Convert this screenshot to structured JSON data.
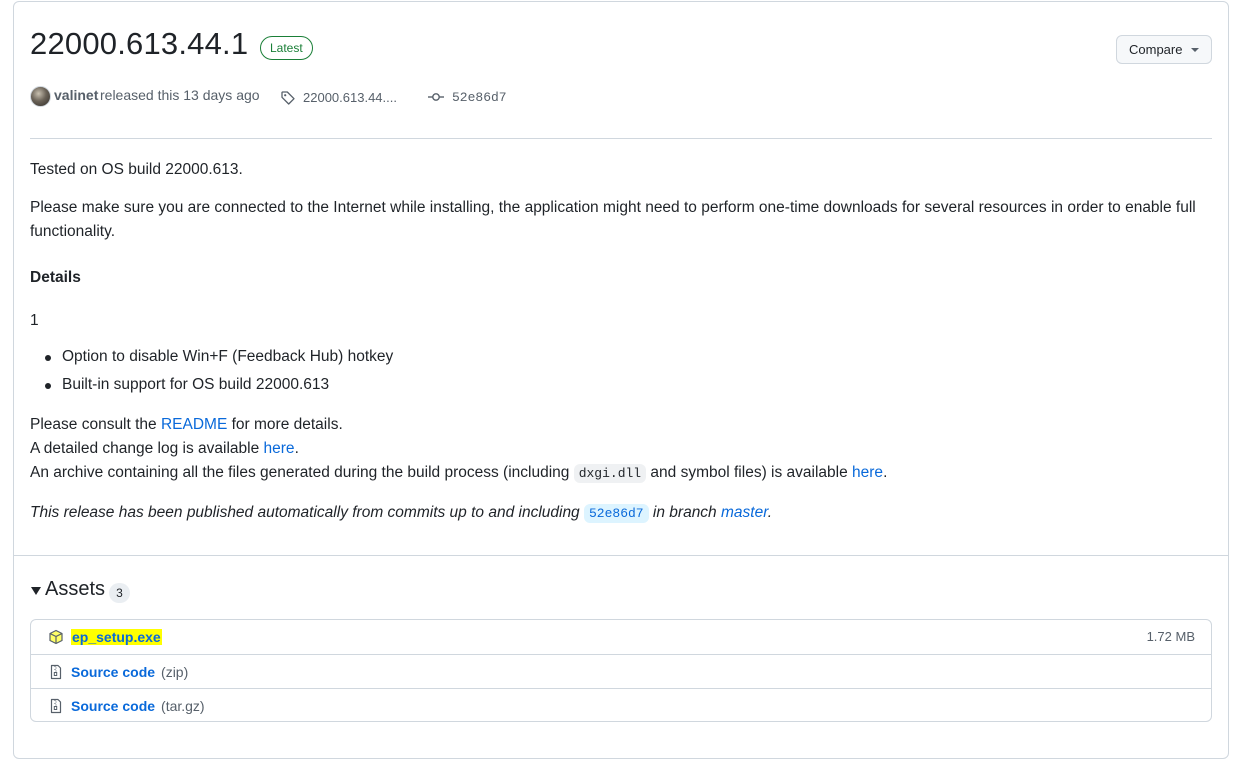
{
  "release": {
    "title": "22000.613.44.1",
    "latest_badge": "Latest",
    "compare_label": "Compare",
    "author": "valinet",
    "released_text": "released this 13 days ago",
    "tag": "22000.613.44....",
    "commit": "52e86d7"
  },
  "notes": {
    "tested": "Tested on OS build 22000.613.",
    "connect": "Please make sure you are connected to the Internet while installing, the application might need to perform one-time downloads for several resources in order to enable full functionality.",
    "details_heading": "Details",
    "number": "1",
    "bullets": [
      "Option to disable Win+F (Feedback Hub) hotkey",
      "Built-in support for OS build 22000.613"
    ],
    "consult_before": "Please consult the ",
    "consult_link": "README",
    "consult_after": " for more details.",
    "changelog_before": "A detailed change log is available ",
    "changelog_link": "here",
    "changelog_after": ".",
    "archive_before": "An archive containing all the files generated during the build process (including ",
    "archive_code": "dxgi.dll",
    "archive_mid": " and symbol files) is available ",
    "archive_link": "here",
    "archive_after": ".",
    "auto_before": "This release has been published automatically from commits up to and including ",
    "auto_code": "52e86d7",
    "auto_mid": " in branch ",
    "auto_link": "master",
    "auto_after": "."
  },
  "assets": {
    "title": "Assets",
    "count": "3",
    "items": [
      {
        "name": "ep_setup.exe",
        "suffix": "",
        "size": "1.72 MB",
        "icon": "package-icon",
        "highlighted": true
      },
      {
        "name": "Source code",
        "suffix": "(zip)",
        "size": "",
        "icon": "file-zip-icon",
        "highlighted": false
      },
      {
        "name": "Source code",
        "suffix": "(tar.gz)",
        "size": "",
        "icon": "file-zip-icon",
        "highlighted": false
      }
    ]
  },
  "colors": {
    "link": "#0969da",
    "latest_green": "#1a7f37",
    "highlight": "#ffff00",
    "border": "#d0d7de"
  }
}
